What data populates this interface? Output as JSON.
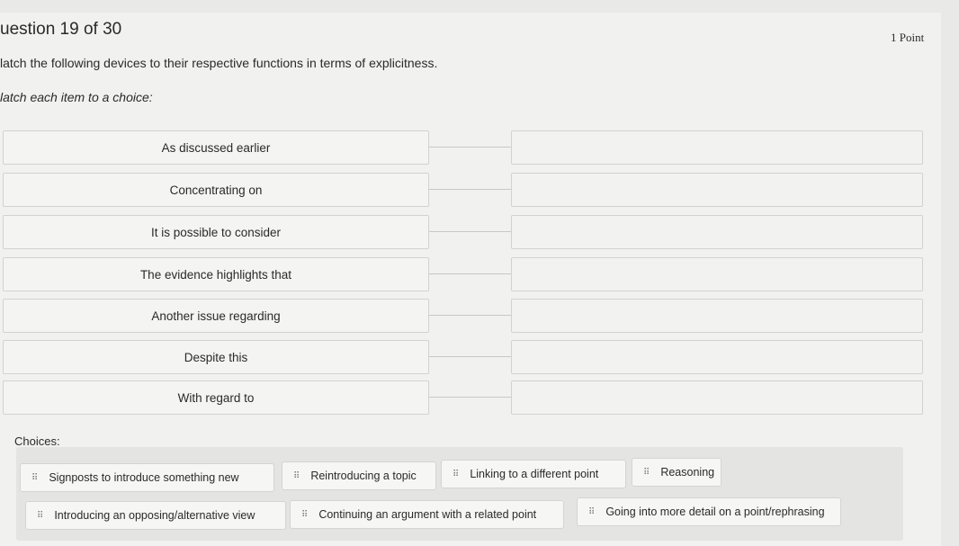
{
  "header": {
    "title": "uestion 19 of 30",
    "points": "1 Point",
    "instruction": "latch the following devices to their respective functions in terms of explicitness.",
    "subinstruction": "latch each item to a choice:"
  },
  "items": [
    "As discussed earlier",
    "Concentrating on",
    "It is possible to consider",
    "The evidence highlights that",
    "Another issue regarding",
    "Despite this",
    "With regard to"
  ],
  "choices_label": "Choices:",
  "choices": [
    "Signposts to introduce something new",
    "Reintroducing a topic",
    "Linking to a different point",
    "Reasoning",
    "Introducing an opposing/alternative view",
    "Continuing an argument with a related point",
    "Going into more detail on a point/rephrasing"
  ],
  "grip_icon": "⠿"
}
